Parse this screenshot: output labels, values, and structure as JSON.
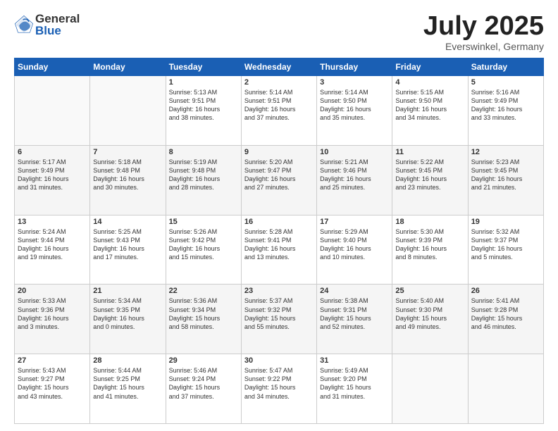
{
  "logo": {
    "general": "General",
    "blue": "Blue"
  },
  "header": {
    "month": "July 2025",
    "location": "Everswinkel, Germany"
  },
  "days_of_week": [
    "Sunday",
    "Monday",
    "Tuesday",
    "Wednesday",
    "Thursday",
    "Friday",
    "Saturday"
  ],
  "weeks": [
    [
      {
        "day": "",
        "info": ""
      },
      {
        "day": "",
        "info": ""
      },
      {
        "day": "1",
        "info": "Sunrise: 5:13 AM\nSunset: 9:51 PM\nDaylight: 16 hours\nand 38 minutes."
      },
      {
        "day": "2",
        "info": "Sunrise: 5:14 AM\nSunset: 9:51 PM\nDaylight: 16 hours\nand 37 minutes."
      },
      {
        "day": "3",
        "info": "Sunrise: 5:14 AM\nSunset: 9:50 PM\nDaylight: 16 hours\nand 35 minutes."
      },
      {
        "day": "4",
        "info": "Sunrise: 5:15 AM\nSunset: 9:50 PM\nDaylight: 16 hours\nand 34 minutes."
      },
      {
        "day": "5",
        "info": "Sunrise: 5:16 AM\nSunset: 9:49 PM\nDaylight: 16 hours\nand 33 minutes."
      }
    ],
    [
      {
        "day": "6",
        "info": "Sunrise: 5:17 AM\nSunset: 9:49 PM\nDaylight: 16 hours\nand 31 minutes."
      },
      {
        "day": "7",
        "info": "Sunrise: 5:18 AM\nSunset: 9:48 PM\nDaylight: 16 hours\nand 30 minutes."
      },
      {
        "day": "8",
        "info": "Sunrise: 5:19 AM\nSunset: 9:48 PM\nDaylight: 16 hours\nand 28 minutes."
      },
      {
        "day": "9",
        "info": "Sunrise: 5:20 AM\nSunset: 9:47 PM\nDaylight: 16 hours\nand 27 minutes."
      },
      {
        "day": "10",
        "info": "Sunrise: 5:21 AM\nSunset: 9:46 PM\nDaylight: 16 hours\nand 25 minutes."
      },
      {
        "day": "11",
        "info": "Sunrise: 5:22 AM\nSunset: 9:45 PM\nDaylight: 16 hours\nand 23 minutes."
      },
      {
        "day": "12",
        "info": "Sunrise: 5:23 AM\nSunset: 9:45 PM\nDaylight: 16 hours\nand 21 minutes."
      }
    ],
    [
      {
        "day": "13",
        "info": "Sunrise: 5:24 AM\nSunset: 9:44 PM\nDaylight: 16 hours\nand 19 minutes."
      },
      {
        "day": "14",
        "info": "Sunrise: 5:25 AM\nSunset: 9:43 PM\nDaylight: 16 hours\nand 17 minutes."
      },
      {
        "day": "15",
        "info": "Sunrise: 5:26 AM\nSunset: 9:42 PM\nDaylight: 16 hours\nand 15 minutes."
      },
      {
        "day": "16",
        "info": "Sunrise: 5:28 AM\nSunset: 9:41 PM\nDaylight: 16 hours\nand 13 minutes."
      },
      {
        "day": "17",
        "info": "Sunrise: 5:29 AM\nSunset: 9:40 PM\nDaylight: 16 hours\nand 10 minutes."
      },
      {
        "day": "18",
        "info": "Sunrise: 5:30 AM\nSunset: 9:39 PM\nDaylight: 16 hours\nand 8 minutes."
      },
      {
        "day": "19",
        "info": "Sunrise: 5:32 AM\nSunset: 9:37 PM\nDaylight: 16 hours\nand 5 minutes."
      }
    ],
    [
      {
        "day": "20",
        "info": "Sunrise: 5:33 AM\nSunset: 9:36 PM\nDaylight: 16 hours\nand 3 minutes."
      },
      {
        "day": "21",
        "info": "Sunrise: 5:34 AM\nSunset: 9:35 PM\nDaylight: 16 hours\nand 0 minutes."
      },
      {
        "day": "22",
        "info": "Sunrise: 5:36 AM\nSunset: 9:34 PM\nDaylight: 15 hours\nand 58 minutes."
      },
      {
        "day": "23",
        "info": "Sunrise: 5:37 AM\nSunset: 9:32 PM\nDaylight: 15 hours\nand 55 minutes."
      },
      {
        "day": "24",
        "info": "Sunrise: 5:38 AM\nSunset: 9:31 PM\nDaylight: 15 hours\nand 52 minutes."
      },
      {
        "day": "25",
        "info": "Sunrise: 5:40 AM\nSunset: 9:30 PM\nDaylight: 15 hours\nand 49 minutes."
      },
      {
        "day": "26",
        "info": "Sunrise: 5:41 AM\nSunset: 9:28 PM\nDaylight: 15 hours\nand 46 minutes."
      }
    ],
    [
      {
        "day": "27",
        "info": "Sunrise: 5:43 AM\nSunset: 9:27 PM\nDaylight: 15 hours\nand 43 minutes."
      },
      {
        "day": "28",
        "info": "Sunrise: 5:44 AM\nSunset: 9:25 PM\nDaylight: 15 hours\nand 41 minutes."
      },
      {
        "day": "29",
        "info": "Sunrise: 5:46 AM\nSunset: 9:24 PM\nDaylight: 15 hours\nand 37 minutes."
      },
      {
        "day": "30",
        "info": "Sunrise: 5:47 AM\nSunset: 9:22 PM\nDaylight: 15 hours\nand 34 minutes."
      },
      {
        "day": "31",
        "info": "Sunrise: 5:49 AM\nSunset: 9:20 PM\nDaylight: 15 hours\nand 31 minutes."
      },
      {
        "day": "",
        "info": ""
      },
      {
        "day": "",
        "info": ""
      }
    ]
  ]
}
